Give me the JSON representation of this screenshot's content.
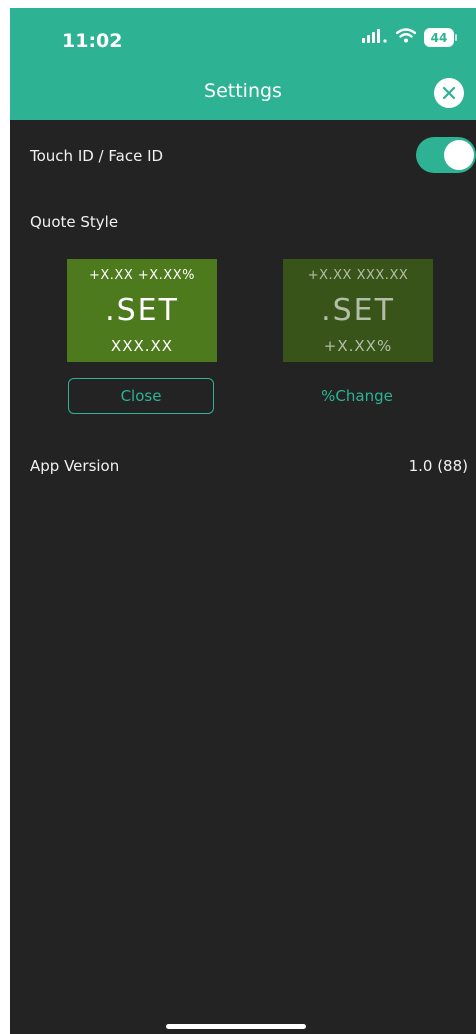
{
  "status_bar": {
    "time": "11:02",
    "battery": "44"
  },
  "header": {
    "title": "Settings"
  },
  "settings": {
    "touch_id_label": "Touch ID / Face ID",
    "touch_id_enabled": true,
    "quote_style_label": "Quote Style",
    "app_version_label": "App Version",
    "app_version_value": "1.0 (88)"
  },
  "quote_styles": [
    {
      "top_line": "+X.XX  +X.XX%",
      "symbol": ".SET",
      "bottom_line": "XXX.XX",
      "button_label": "Close",
      "selected": true
    },
    {
      "top_line": "+X.XX  XXX.XX",
      "symbol": ".SET",
      "bottom_line": "+X.XX%",
      "button_label": "%Change",
      "selected": false
    }
  ],
  "colors": {
    "accent": "#2db394",
    "background": "#232323",
    "card_selected": "#4c7a1d",
    "card_unselected": "#395419"
  }
}
